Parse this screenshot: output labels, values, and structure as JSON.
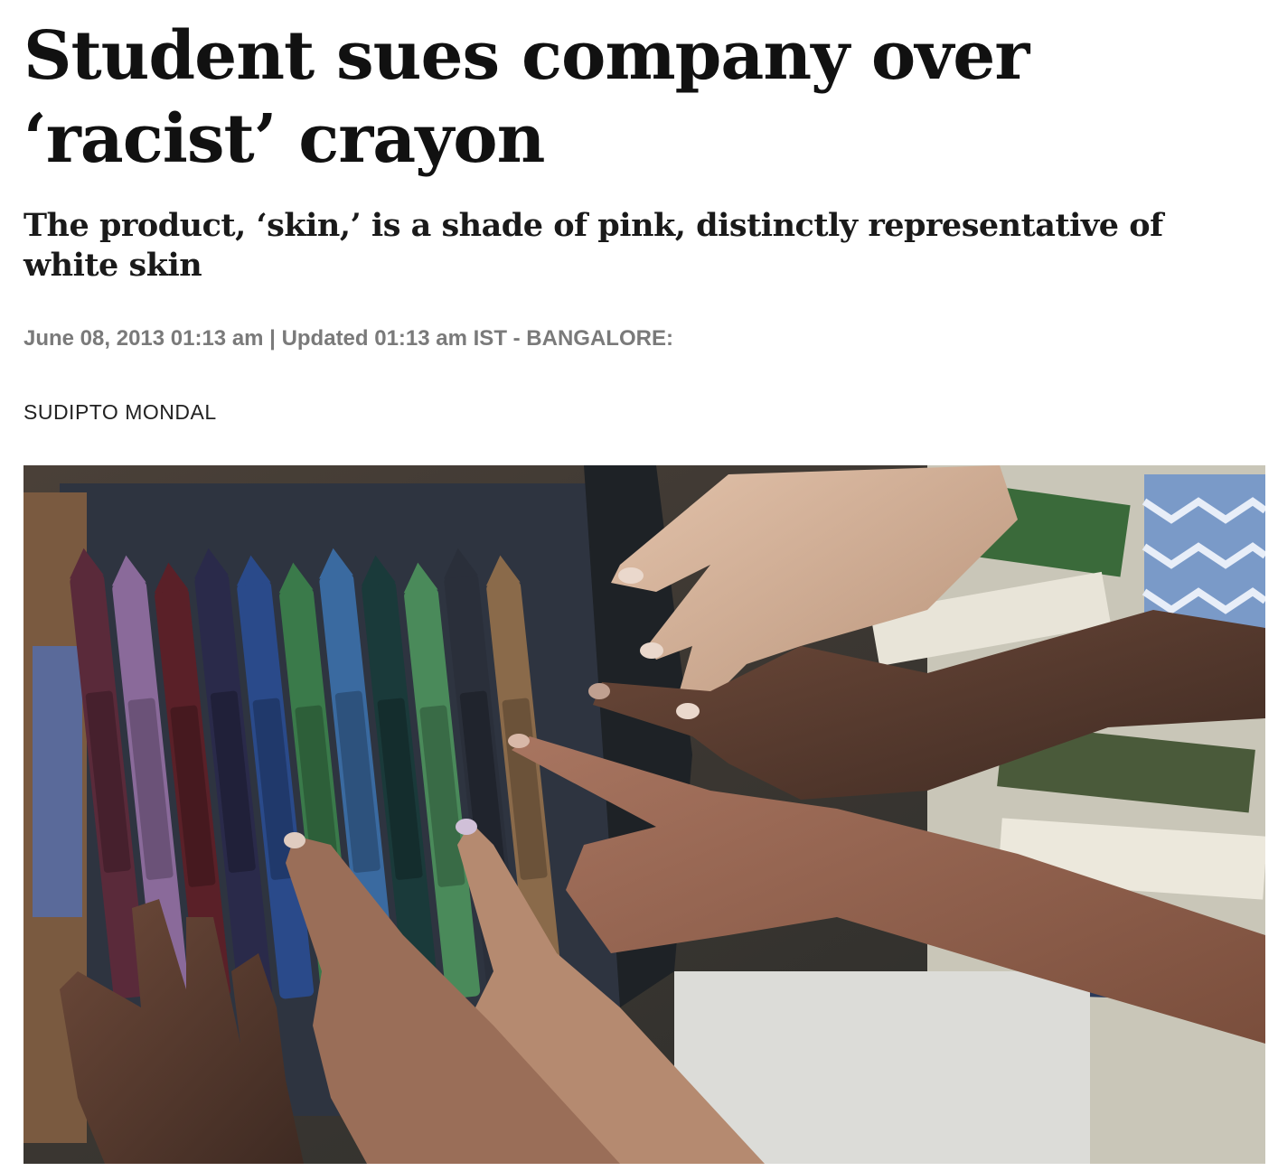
{
  "article": {
    "headline_line1": "Student sues company over",
    "headline_line2": "‘racist’ crayon",
    "subheadline": "The product, ‘skin,’ is a shade of pink, distinctly representative of white skin",
    "dateline": "June 08, 2013 01:13 am | Updated 01:13 am IST - BANGALORE:",
    "author": "SUDIPTO MONDAL"
  },
  "photo": {
    "subject": "hands-pointing-at-crayon-box",
    "crayon_colors": [
      "#5a2a3a",
      "#8a6a9a",
      "#5a2028",
      "#2a2a4a",
      "#2a4a8a",
      "#3a7a4a",
      "#3a6aa0",
      "#1a3a3a",
      "#4a8a5a",
      "#2a2f3a",
      "#8a6a4a"
    ]
  }
}
